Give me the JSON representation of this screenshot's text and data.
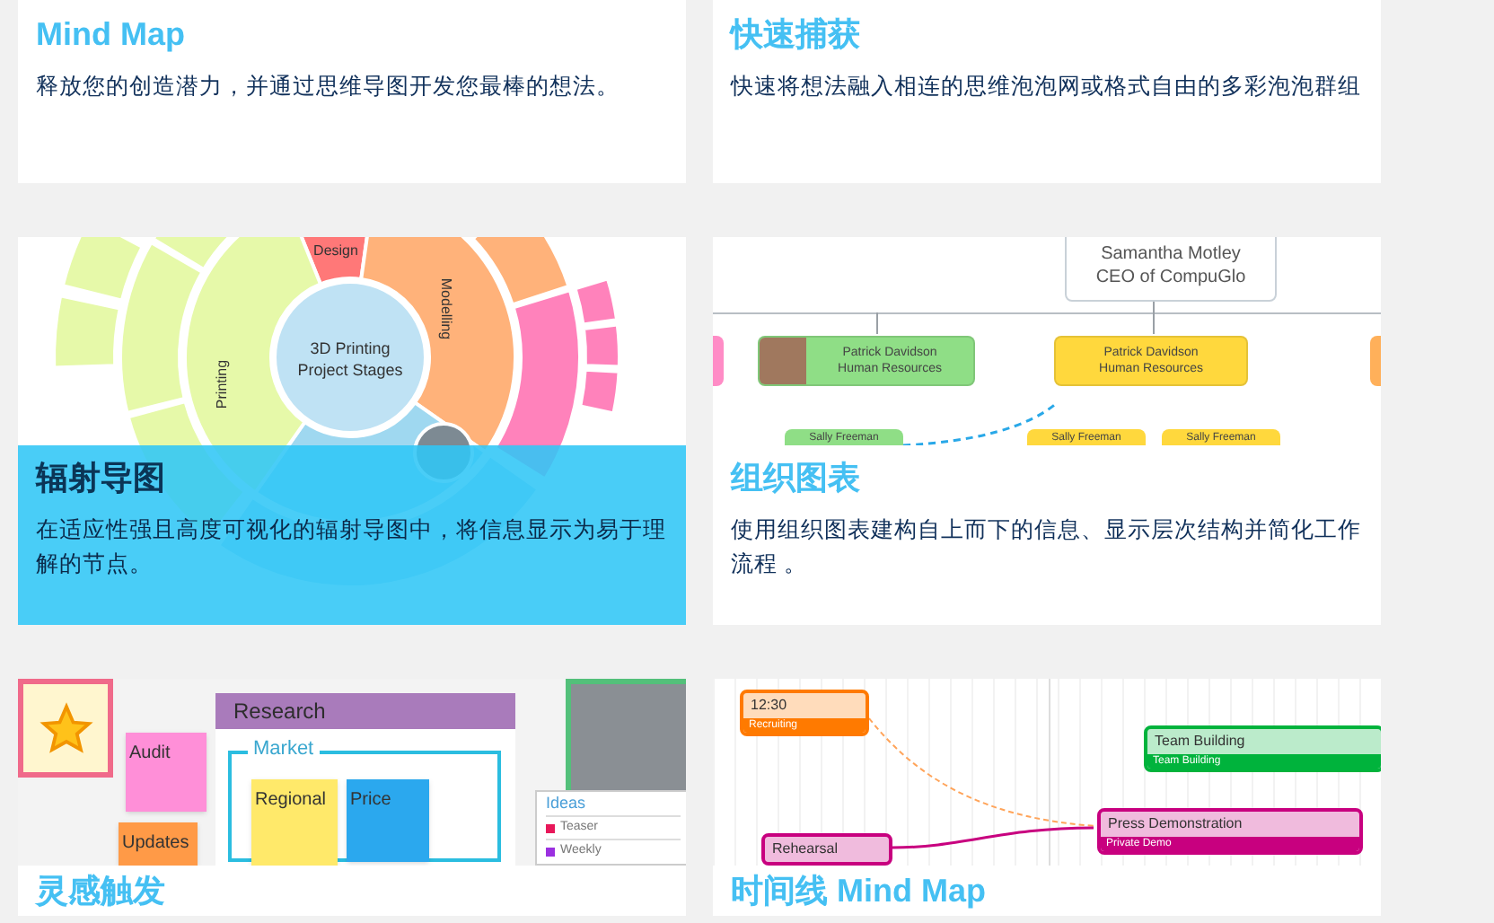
{
  "cards": [
    {
      "kind": "text",
      "title": "Mind Map",
      "description": "释放您的创造潜力，并通过思维导图开发您最棒的想法。",
      "highlighted": false
    },
    {
      "kind": "text",
      "title": "快速捕获",
      "description": "快速将想法融入相连的思维泡泡网或格式自由的多彩泡泡群组",
      "highlighted": false
    },
    {
      "kind": "image",
      "title": "辐射导图",
      "description": "在适应性强且高度可视化的辐射导图中，将信息显示为易于理解的节点。",
      "highlighted": true,
      "illustration": {
        "kind": "radial",
        "center": [
          "3D Printing",
          "Project Stages"
        ],
        "segments": [
          "Design",
          "Modelling",
          "Printing"
        ]
      }
    },
    {
      "kind": "image",
      "title": "组织图表",
      "description": "使用组织图表建构自上而下的信息、显示层次结构并简化工作流程 。",
      "highlighted": false,
      "illustration": {
        "kind": "org",
        "head": [
          "Samantha Motley",
          "CEO of CompuGlo"
        ],
        "managers": [
          {
            "name": "Patrick Davidson",
            "role": "Human Resources",
            "color": "#8fde86"
          },
          {
            "name": "Patrick Davidson",
            "role": "Human Resources",
            "color": "#ffd83d"
          }
        ],
        "staff": [
          {
            "name": "Sally Freeman",
            "color": "#8fde86"
          },
          {
            "name": "Sally Freeman",
            "color": "#ffd83d"
          },
          {
            "name": "Sally Freeman",
            "color": "#ffd83d"
          }
        ]
      }
    },
    {
      "kind": "image",
      "title": "灵感触发",
      "highlighted": false,
      "illustration": {
        "kind": "board",
        "header": "Research",
        "frame": "Market",
        "notes": [
          {
            "label": "Audit",
            "color": "#ff8fd8"
          },
          {
            "label": "Updates",
            "color": "#ff9a47"
          },
          {
            "label": "Regional",
            "color": "#ffe96a"
          },
          {
            "label": "Price",
            "color": "#2ba8ee"
          }
        ],
        "list": {
          "title": "Ideas",
          "items": [
            {
              "label": "Teaser",
              "color": "#e8185a"
            },
            {
              "label": "Weekly",
              "color": "#9b30e0"
            }
          ]
        }
      }
    },
    {
      "kind": "image",
      "title": "时间线 Mind Map",
      "highlighted": false,
      "illustration": {
        "kind": "timeline",
        "events": [
          {
            "title": "12:30",
            "subtitle": "Recruiting",
            "color": "#ff7a00"
          },
          {
            "title": "Team Building",
            "subtitle": "Team Building",
            "color": "#00b33c"
          },
          {
            "title": "Press Demonstration",
            "subtitle": "Private Demo",
            "color": "#c8007f"
          },
          {
            "title": "Rehearsal",
            "color": "#c8007f"
          }
        ]
      }
    }
  ]
}
